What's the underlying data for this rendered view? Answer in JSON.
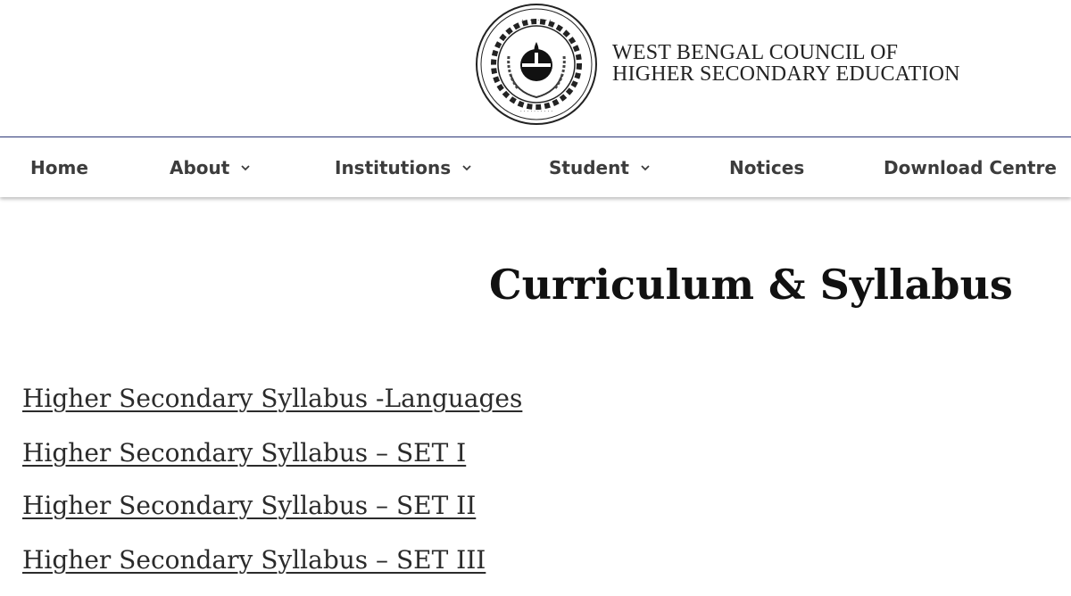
{
  "header": {
    "org_name_line1": "WEST BENGAL COUNCIL OF",
    "org_name_line2": "HIGHER SECONDARY EDUCATION",
    "logo_icon": "council-seal-logo"
  },
  "nav": {
    "items": [
      {
        "label": "Home",
        "has_dropdown": false
      },
      {
        "label": "About",
        "has_dropdown": true
      },
      {
        "label": "Institutions",
        "has_dropdown": true
      },
      {
        "label": "Student",
        "has_dropdown": true
      },
      {
        "label": "Notices",
        "has_dropdown": false
      },
      {
        "label": "Download Centre",
        "has_dropdown": false
      }
    ],
    "border_color": "#2f3a7a"
  },
  "main": {
    "title": "Curriculum & Syllabus",
    "links": [
      "Higher Secondary Syllabus -Languages",
      "Higher Secondary Syllabus – SET I",
      "Higher Secondary Syllabus – SET II",
      "Higher Secondary Syllabus – SET III"
    ]
  }
}
